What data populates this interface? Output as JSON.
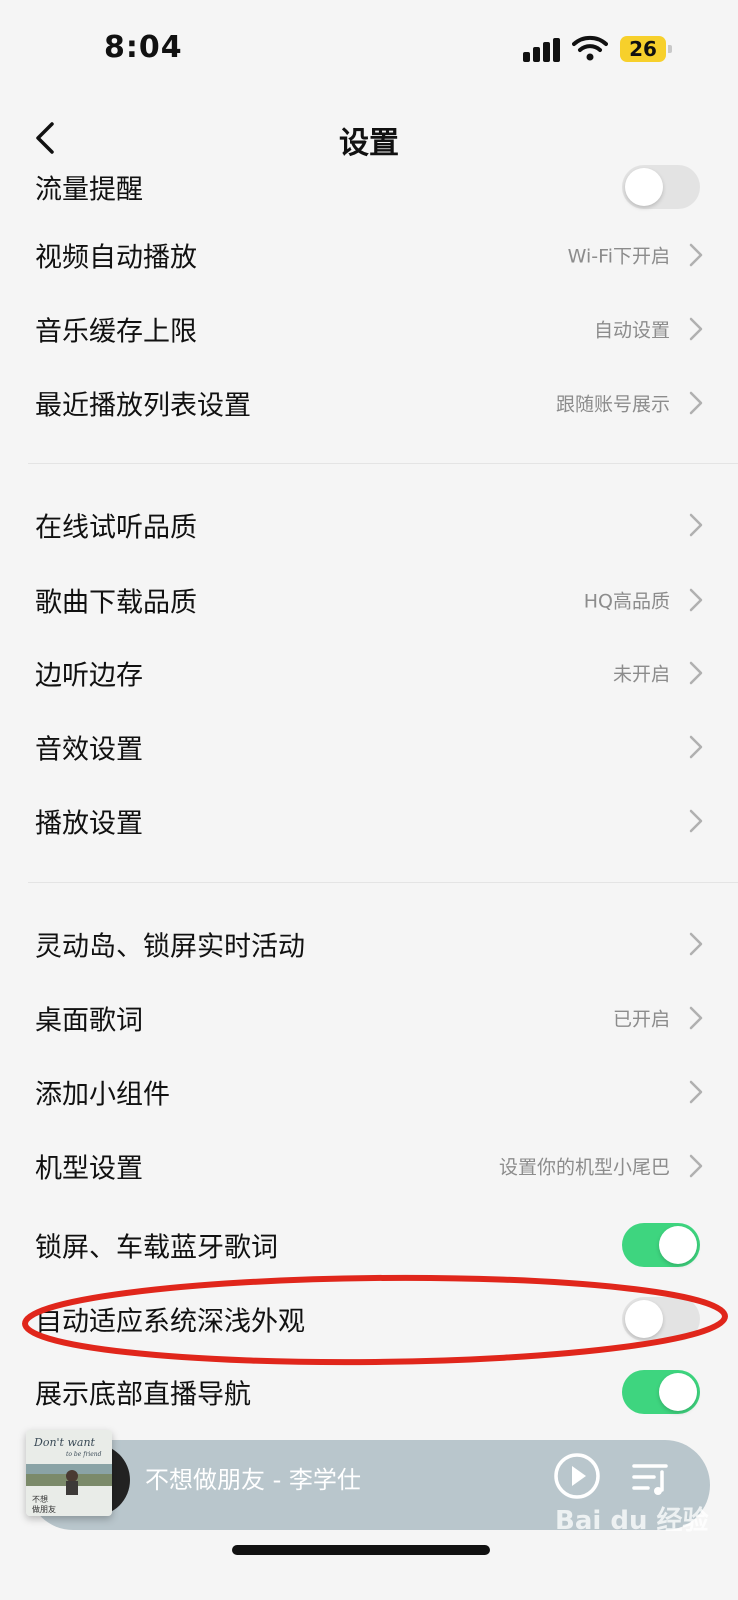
{
  "status_bar": {
    "time": "8:04",
    "battery": "26"
  },
  "nav": {
    "title": "设置"
  },
  "rows": [
    {
      "id": "traffic-alert",
      "label": "流量提醒",
      "toggle": false
    },
    {
      "id": "video-autoplay",
      "label": "视频自动播放",
      "value": "Wi-Fi下开启"
    },
    {
      "id": "music-cache-limit",
      "label": "音乐缓存上限",
      "value": "自动设置"
    },
    {
      "id": "recent-playlist-settings",
      "label": "最近播放列表设置",
      "value": "跟随账号展示"
    },
    {
      "id": "online-quality",
      "label": "在线试听品质",
      "value": ""
    },
    {
      "id": "download-quality",
      "label": "歌曲下载品质",
      "value": "HQ高品质"
    },
    {
      "id": "listen-and-save",
      "label": "边听边存",
      "value": "未开启"
    },
    {
      "id": "sound-effects",
      "label": "音效设置",
      "value": ""
    },
    {
      "id": "playback-settings",
      "label": "播放设置",
      "value": ""
    },
    {
      "id": "dynamic-island",
      "label": "灵动岛、锁屏实时活动",
      "value": ""
    },
    {
      "id": "desktop-lyrics",
      "label": "桌面歌词",
      "value": "已开启"
    },
    {
      "id": "add-widget",
      "label": "添加小组件",
      "value": ""
    },
    {
      "id": "device-model",
      "label": "机型设置",
      "value": "设置你的机型小尾巴"
    },
    {
      "id": "lockscreen-lyrics",
      "label": "锁屏、车载蓝牙歌词",
      "toggle": true
    },
    {
      "id": "auto-appearance",
      "label": "自动适应系统深浅外观",
      "toggle": false
    },
    {
      "id": "live-nav",
      "label": "展示底部直播导航",
      "toggle": true
    }
  ],
  "player": {
    "song": "不想做朋友 - 李学仕",
    "album_text": "Don't want to be friend 不想做朋友"
  },
  "watermark": "Bai du 经验",
  "colors": {
    "toggle_on": "#3ed57f",
    "toggle_off": "#e3e3e3",
    "annotation": "#e0261b",
    "player_bg": "#b9c6cc"
  }
}
